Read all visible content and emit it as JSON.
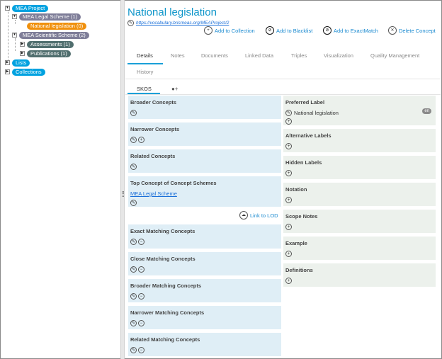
{
  "tree": {
    "project": "MEA Project",
    "legal_scheme": "MEA Legal Scheme (1)",
    "national_legislation": "National legislation (0)",
    "scientific_scheme": "MEA Scientific Scheme (2)",
    "assessments": "Assessments (1)",
    "publications": "Publications (1)",
    "lists": "Lists",
    "collections": "Collections"
  },
  "concept": {
    "title": "National legislation",
    "uri": "https://vocabulary.brismeas.org/MEAProject/2"
  },
  "actions": {
    "add_collection": "Add to Collection",
    "add_blacklist": "Add to Blacklist",
    "add_exactmatch": "Add to ExactMatch",
    "delete": "Delete Concept"
  },
  "tabs": [
    "Details",
    "Notes",
    "Documents",
    "Linked Data",
    "Triples",
    "Visualization",
    "Quality Management",
    "History"
  ],
  "subtabs": {
    "skos": "SKOS",
    "person": "+"
  },
  "left": {
    "broader": "Broader Concepts",
    "narrower": "Narrower Concepts",
    "related": "Related Concepts",
    "top_concept": "Top Concept of Concept Schemes",
    "top_concept_value": "MEA Legal Scheme",
    "link_lod": "Link to LOD",
    "exact": "Exact Matching Concepts",
    "close": "Close Matching Concepts",
    "broader_match": "Broader Matching Concepts",
    "narrower_match": "Narrower Matching Concepts",
    "related_match": "Related Matching Concepts"
  },
  "right": {
    "pref_label": "Preferred Label",
    "pref_value": "National legislation",
    "pref_lang": "en",
    "alt_labels": "Alternative Labels",
    "hidden_labels": "Hidden Labels",
    "notation": "Notation",
    "scope_notes": "Scope Notes",
    "example": "Example",
    "definitions": "Definitions"
  },
  "colors": {
    "accent": "#0d95c9",
    "tree_blue": "#00a2e0",
    "tree_gray": "#7e7d98",
    "tree_orange": "#f0900d",
    "tree_dark": "#506e6e",
    "left_panel": "#dfeef6",
    "right_panel": "#ecf1ec"
  }
}
